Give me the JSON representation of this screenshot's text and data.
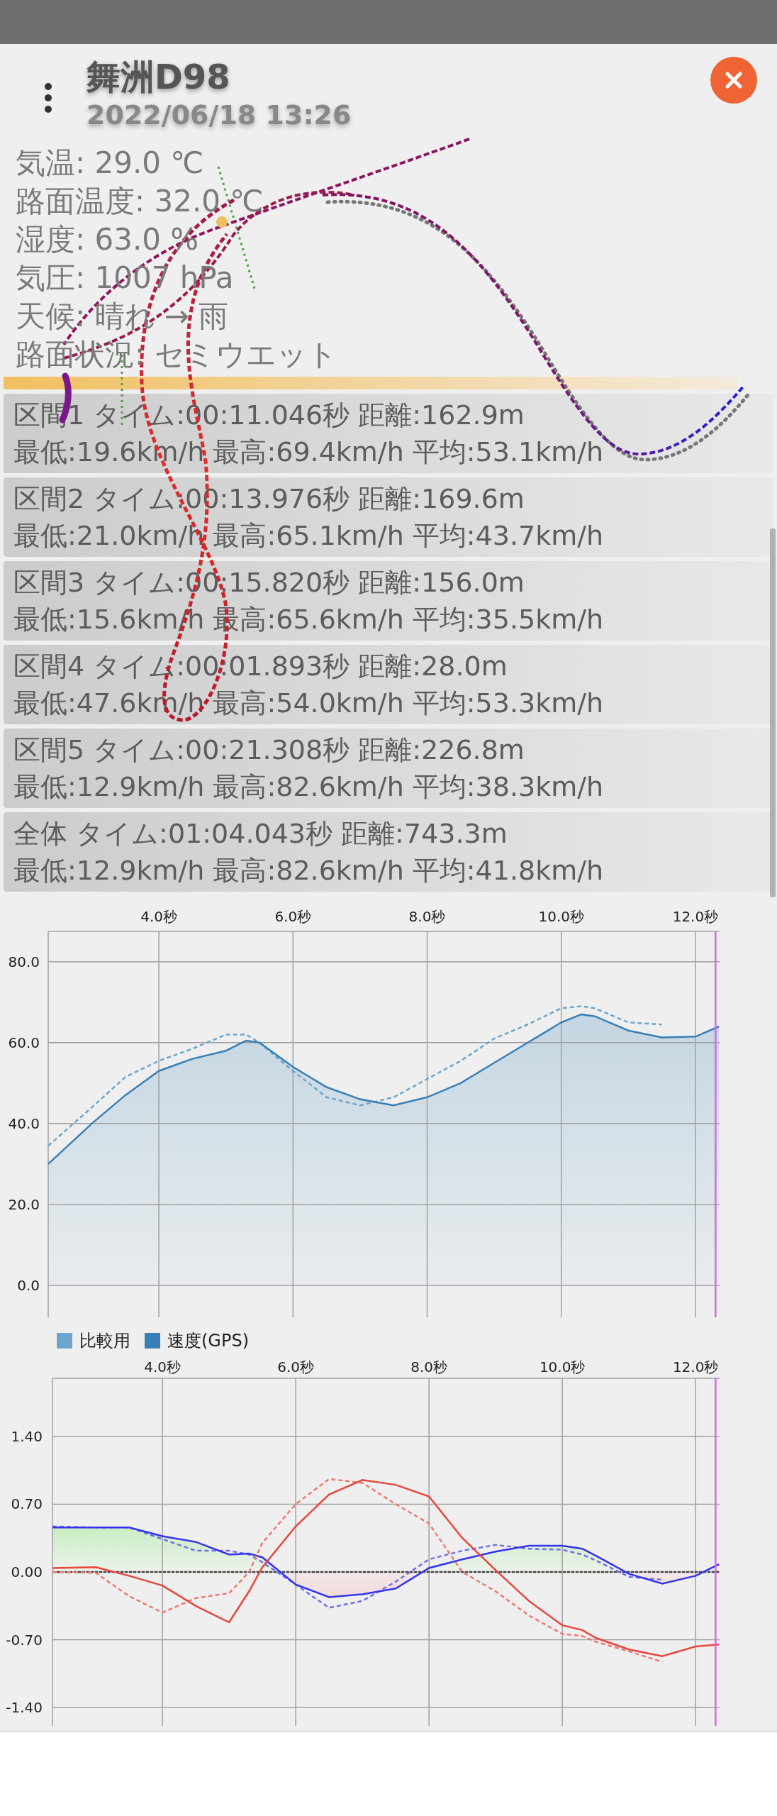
{
  "header": {
    "title": "舞洲D98",
    "datetime": "2022/06/18 13:26"
  },
  "conditions": [
    "気温: 29.0 ℃",
    "路面温度: 32.0 ℃",
    "湿度: 63.0 %",
    "気圧: 1007 hPa",
    "天候: 晴れ → 雨",
    "路面状況: セミウエット"
  ],
  "sections": [
    {
      "line1": "区間1 タイム:00:11.046秒 距離:162.9m",
      "line2": "最低:19.6km/h 最高:69.4km/h 平均:53.1km/h"
    },
    {
      "line1": "区間2 タイム:00:13.976秒 距離:169.6m",
      "line2": "最低:21.0km/h 最高:65.1km/h 平均:43.7km/h"
    },
    {
      "line1": "区間3 タイム:00:15.820秒 距離:156.0m",
      "line2": "最低:15.6km/h 最高:65.6km/h 平均:35.5km/h"
    },
    {
      "line1": "区間4 タイム:00:01.893秒 距離:28.0m",
      "line2": "最低:47.6km/h 最高:54.0km/h 平均:53.3km/h"
    },
    {
      "line1": "区間5 タイム:00:21.308秒 距離:226.8m",
      "line2": "最低:12.9km/h 最高:82.6km/h 平均:38.3km/h"
    },
    {
      "line1": "全体  タイム:01:04.043秒 距離:743.3m",
      "line2": "最低:12.9km/h 最高:82.6km/h 平均:41.8km/h"
    }
  ],
  "speed_chart": {
    "chart_data": {
      "type": "line",
      "x": [
        2.35,
        3,
        3.5,
        4,
        4.5,
        5,
        5.3,
        5.5,
        6,
        6.5,
        7,
        7.5,
        8,
        8.5,
        9,
        9.5,
        10,
        10.3,
        10.5,
        11,
        11.5,
        12,
        12.35
      ],
      "series": [
        {
          "name": "比較用",
          "color": "#6ea6cb",
          "type": "line",
          "line_style": "dashed",
          "values": [
            34.5,
            44,
            51.5,
            55.5,
            58.5,
            62,
            62,
            60,
            53,
            46.5,
            44.5,
            46.5,
            51,
            55.5,
            61,
            64.5,
            68.5,
            69,
            68.5,
            65,
            64.5,
            null,
            null
          ]
        },
        {
          "name": "速度(GPS)",
          "color": "#3a7fb5",
          "type": "area",
          "line_style": "solid",
          "values": [
            30,
            40,
            47,
            53,
            56,
            58,
            60.5,
            60,
            54,
            49,
            46,
            44.5,
            46.5,
            50,
            55,
            60,
            65,
            67,
            66.5,
            63,
            61.3,
            61.5,
            64
          ]
        }
      ],
      "xlim": [
        2.35,
        12.36
      ],
      "ylim": [
        -7.9,
        87.5
      ],
      "xticks": [
        {
          "value": 4,
          "label": "4.0秒"
        },
        {
          "value": 6,
          "label": "6.0秒"
        },
        {
          "value": 8,
          "label": "8.0秒"
        },
        {
          "value": 10,
          "label": "10.0秒"
        },
        {
          "value": 12,
          "label": "12.0秒"
        }
      ],
      "yticks": [
        {
          "value": 0,
          "label": "0.0"
        },
        {
          "value": 20,
          "label": "20.0"
        },
        {
          "value": 40,
          "label": "40.0"
        },
        {
          "value": 60,
          "label": "60.0"
        },
        {
          "value": 80,
          "label": "80.0"
        }
      ],
      "grid": true,
      "ref_lines": [
        {
          "axis": "x",
          "value": 12.3
        }
      ]
    }
  },
  "g_chart": {
    "chart_data": {
      "type": "line",
      "x": [
        2.35,
        3,
        3.5,
        4,
        4.5,
        5,
        5.3,
        5.5,
        6,
        6.5,
        7,
        7.5,
        8,
        8.5,
        9,
        9.5,
        10,
        10.3,
        10.5,
        11,
        11.5,
        12,
        12.35
      ],
      "series": [
        {
          "color": "#7070ea",
          "type": "line",
          "line_style": "dashed",
          "values": [
            0.47,
            0.46,
            0.46,
            0.34,
            0.22,
            0.22,
            0.18,
            0.1,
            -0.13,
            -0.37,
            -0.3,
            -0.1,
            0.13,
            0.22,
            0.28,
            0.24,
            0.23,
            0.18,
            0.12,
            -0.05,
            -0.08,
            null,
            null
          ]
        },
        {
          "color": "#3434f0",
          "type": "area",
          "line_style": "solid",
          "values": [
            0.46,
            0.46,
            0.46,
            0.37,
            0.31,
            0.18,
            0.19,
            0.15,
            -0.13,
            -0.26,
            -0.23,
            -0.17,
            0.04,
            0.13,
            0.21,
            0.27,
            0.27,
            0.24,
            0.17,
            -0.02,
            -0.12,
            -0.04,
            0.08
          ]
        },
        {
          "color": "#ee7a70",
          "type": "line",
          "line_style": "dashed",
          "values": [
            0,
            -0.01,
            -0.25,
            -0.42,
            -0.27,
            -0.22,
            0,
            0.3,
            0.7,
            0.96,
            0.92,
            0.7,
            0.5,
            0,
            -0.2,
            -0.45,
            -0.64,
            -0.66,
            -0.72,
            -0.82,
            -0.93,
            null,
            null
          ]
        },
        {
          "color": "#e8463c",
          "type": "line",
          "line_style": "solid",
          "values": [
            0.04,
            0.05,
            -0.04,
            -0.14,
            -0.35,
            -0.52,
            -0.2,
            0.05,
            0.47,
            0.8,
            0.95,
            0.9,
            0.78,
            0.35,
            0.02,
            -0.3,
            -0.55,
            -0.6,
            -0.68,
            -0.8,
            -0.87,
            -0.77,
            -0.75
          ]
        }
      ],
      "xlim": [
        2.35,
        12.36
      ],
      "ylim": [
        -1.59,
        2.0
      ],
      "xticks": [
        {
          "value": 4,
          "label": "4.0秒"
        },
        {
          "value": 6,
          "label": "6.0秒"
        },
        {
          "value": 8,
          "label": "8.0秒"
        },
        {
          "value": 10,
          "label": "10.0秒"
        },
        {
          "value": 12,
          "label": "12.0秒"
        }
      ],
      "yticks": [
        {
          "value": -1.4,
          "label": "-1.40"
        },
        {
          "value": -0.7,
          "label": "-0.70"
        },
        {
          "value": 0,
          "label": "0.00"
        },
        {
          "value": 0.7,
          "label": "0.70"
        },
        {
          "value": 1.4,
          "label": "1.40"
        }
      ],
      "grid": true,
      "ref_lines": [
        {
          "axis": "y",
          "value": 0
        },
        {
          "axis": "x",
          "value": 12.3
        }
      ]
    }
  }
}
